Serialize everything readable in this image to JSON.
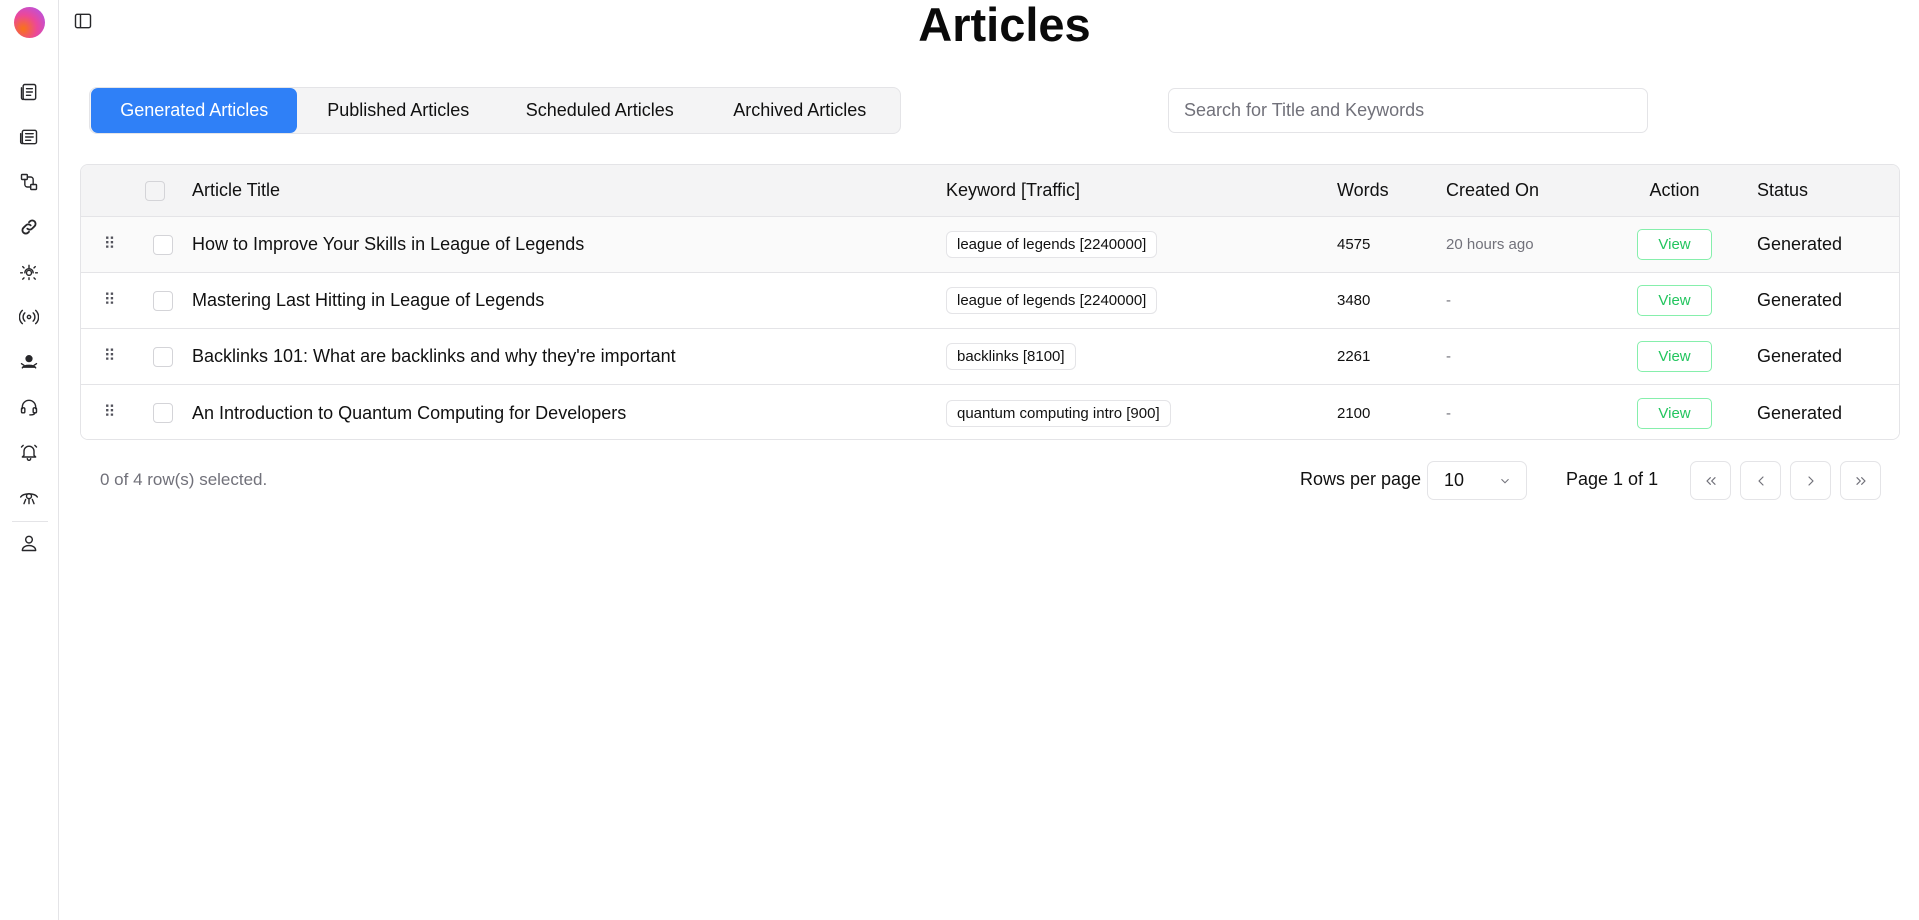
{
  "page": {
    "title": "Articles"
  },
  "sidebar": {
    "items": [
      {
        "icon": "document-list-icon"
      },
      {
        "icon": "newspaper-icon"
      },
      {
        "icon": "workflow-icon"
      },
      {
        "icon": "link-icon"
      },
      {
        "icon": "settings-cog-icon"
      },
      {
        "icon": "radar-icon"
      },
      {
        "icon": "community-icon"
      },
      {
        "icon": "support-headset-icon"
      },
      {
        "icon": "bell-icon"
      },
      {
        "icon": "insights-icon"
      },
      {
        "icon": "user-icon"
      }
    ]
  },
  "tabs": [
    {
      "label": "Generated Articles",
      "active": true
    },
    {
      "label": "Published Articles",
      "active": false
    },
    {
      "label": "Scheduled Articles",
      "active": false
    },
    {
      "label": "Archived Articles",
      "active": false
    }
  ],
  "search": {
    "placeholder": "Search for Title and Keywords"
  },
  "table": {
    "headers": {
      "title": "Article Title",
      "keyword": "Keyword [Traffic]",
      "words": "Words",
      "created": "Created On",
      "action": "Action",
      "status": "Status"
    },
    "rows": [
      {
        "title": "How to Improve Your Skills in League of Legends",
        "keyword": "league of legends [2240000]",
        "words": "4575",
        "created": "20 hours ago",
        "action": "View",
        "status": "Generated"
      },
      {
        "title": "Mastering Last Hitting in League of Legends",
        "keyword": "league of legends [2240000]",
        "words": "3480",
        "created": "-",
        "action": "View",
        "status": "Generated"
      },
      {
        "title": "Backlinks 101: What are backlinks and why they're important",
        "keyword": "backlinks [8100]",
        "words": "2261",
        "created": "-",
        "action": "View",
        "status": "Generated"
      },
      {
        "title": "An Introduction to Quantum Computing for Developers",
        "keyword": "quantum computing intro [900]",
        "words": "2100",
        "created": "-",
        "action": "View",
        "status": "Generated"
      }
    ]
  },
  "footer": {
    "selection": "0 of 4 row(s) selected.",
    "rows_per_page_label": "Rows per page",
    "rows_per_page_value": "10",
    "page_label": "Page 1 of 1"
  },
  "colors": {
    "accent": "#2f80f7",
    "view_button": "#22c55e"
  }
}
